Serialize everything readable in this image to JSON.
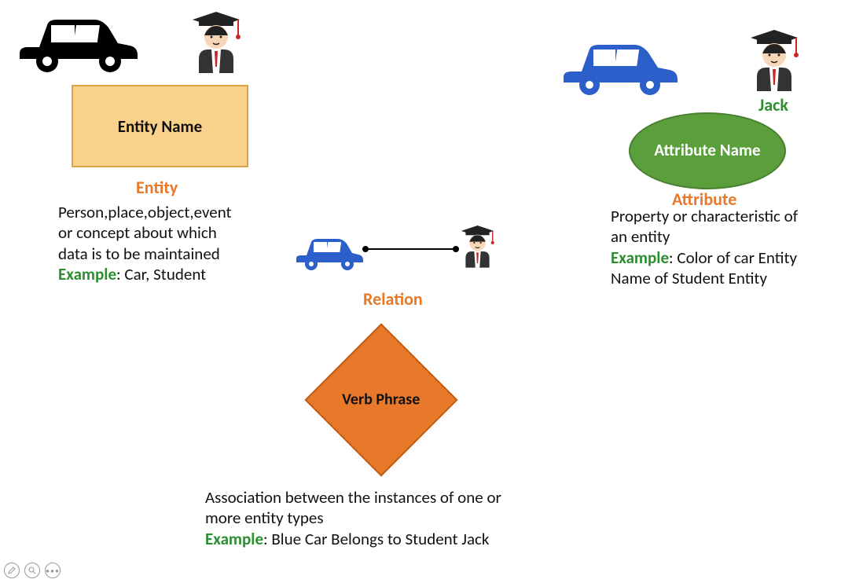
{
  "entity": {
    "shape_label": "Entity Name",
    "heading": "Entity",
    "desc_line1": "Person,place,object,event",
    "desc_line2": "or concept about which",
    "desc_line3": "data is to be maintained",
    "example_label": "Example",
    "example_text": ": Car, Student"
  },
  "attribute": {
    "shape_label": "Attribute Name",
    "heading": "Attribute",
    "jack_label": "Jack",
    "desc_line1": "Property or characteristic of",
    "desc_line2": "an entity",
    "example_label": "Example",
    "example_text1": ": Color of car Entity",
    "example_text2": "Name of Student Entity"
  },
  "relation": {
    "shape_label": "Verb Phrase",
    "heading": "Relation",
    "desc_line1": "Association between the instances of one or",
    "desc_line2": "more entity types",
    "example_label": "Example",
    "example_text": ": Blue Car Belongs to Student Jack"
  }
}
